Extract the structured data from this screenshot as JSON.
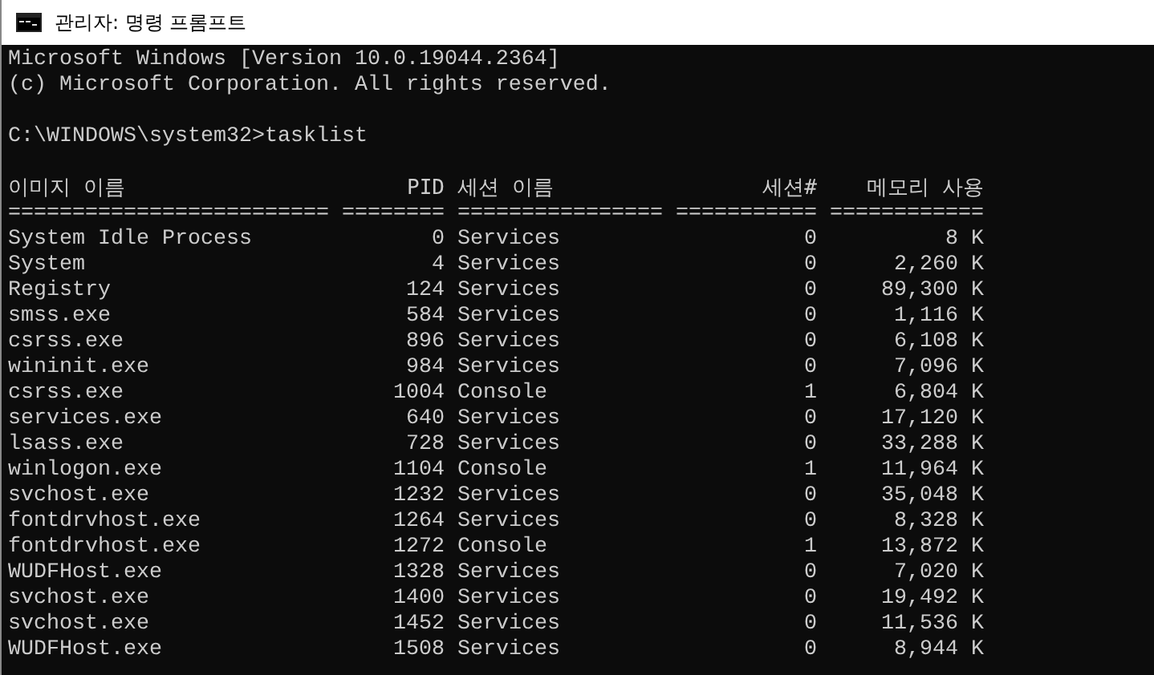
{
  "window": {
    "title": "관리자: 명령 프롬프트"
  },
  "console": {
    "banner": [
      "Microsoft Windows [Version 10.0.19044.2364]",
      "(c) Microsoft Corporation. All rights reserved."
    ],
    "prompt": "C:\\WINDOWS\\system32>tasklist",
    "table": {
      "columns": [
        "이미지 이름",
        "PID",
        "세션 이름",
        "세션#",
        "메모리 사용"
      ],
      "separators": [
        "=========================",
        "========",
        "================",
        "===========",
        "============"
      ],
      "rows": [
        [
          "System Idle Process",
          "0",
          "Services",
          "0",
          "8 K"
        ],
        [
          "System",
          "4",
          "Services",
          "0",
          "2,260 K"
        ],
        [
          "Registry",
          "124",
          "Services",
          "0",
          "89,300 K"
        ],
        [
          "smss.exe",
          "584",
          "Services",
          "0",
          "1,116 K"
        ],
        [
          "csrss.exe",
          "896",
          "Services",
          "0",
          "6,108 K"
        ],
        [
          "wininit.exe",
          "984",
          "Services",
          "0",
          "7,096 K"
        ],
        [
          "csrss.exe",
          "1004",
          "Console",
          "1",
          "6,804 K"
        ],
        [
          "services.exe",
          "640",
          "Services",
          "0",
          "17,120 K"
        ],
        [
          "lsass.exe",
          "728",
          "Services",
          "0",
          "33,288 K"
        ],
        [
          "winlogon.exe",
          "1104",
          "Console",
          "1",
          "11,964 K"
        ],
        [
          "svchost.exe",
          "1232",
          "Services",
          "0",
          "35,048 K"
        ],
        [
          "fontdrvhost.exe",
          "1264",
          "Services",
          "0",
          "8,328 K"
        ],
        [
          "fontdrvhost.exe",
          "1272",
          "Console",
          "1",
          "13,872 K"
        ],
        [
          "WUDFHost.exe",
          "1328",
          "Services",
          "0",
          "7,020 K"
        ],
        [
          "svchost.exe",
          "1400",
          "Services",
          "0",
          "19,492 K"
        ],
        [
          "svchost.exe",
          "1452",
          "Services",
          "0",
          "11,536 K"
        ],
        [
          "WUDFHost.exe",
          "1508",
          "Services",
          "0",
          "8,944 K"
        ]
      ]
    }
  }
}
